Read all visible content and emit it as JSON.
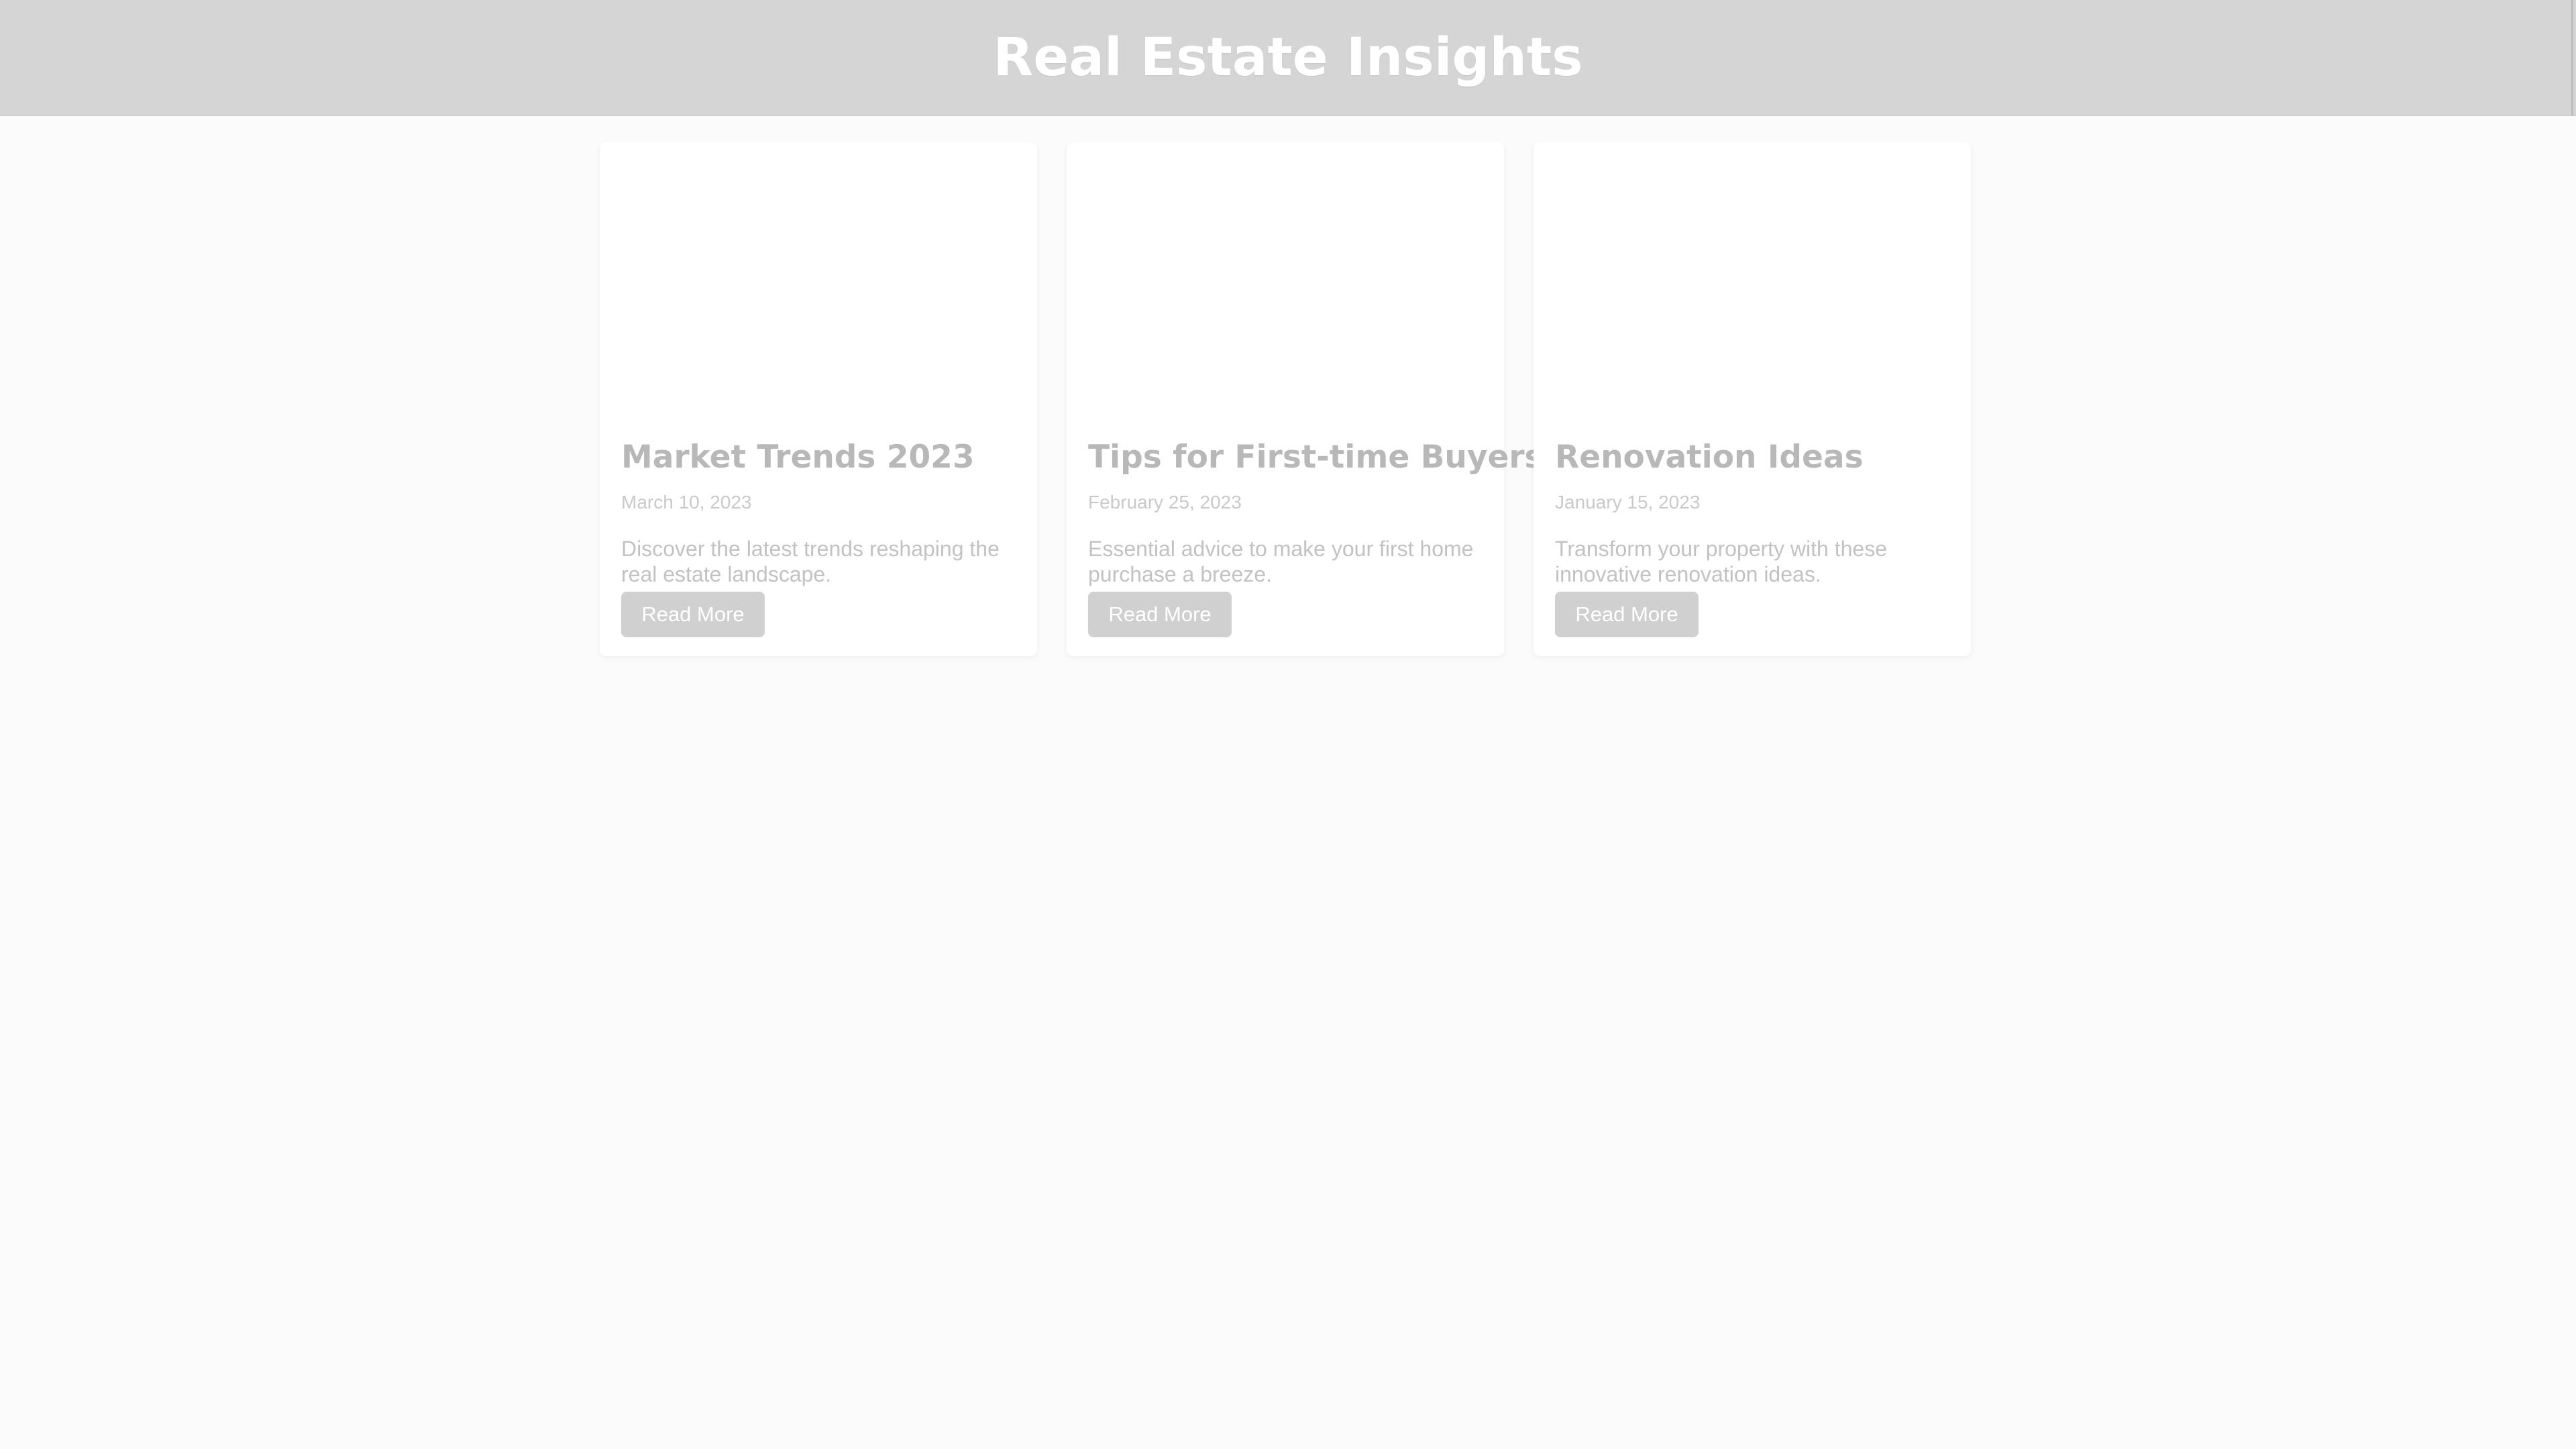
{
  "header": {
    "title": "Real Estate Insights"
  },
  "colors": {
    "header_bg": "#d5d5d5",
    "page_bg": "#fbfbfb",
    "card_bg": "#ffffff",
    "button_bg": "#d0d0d0",
    "title_text": "#b8b8b8"
  },
  "articles": [
    {
      "title": "Market Trends 2023",
      "date": "March 10, 2023",
      "description": "Discover the latest trends reshaping the real estate landscape.",
      "button_label": "Read More"
    },
    {
      "title": "Tips for First-time Buyers",
      "date": "February 25, 2023",
      "description": "Essential advice to make your first home purchase a breeze.",
      "button_label": "Read More"
    },
    {
      "title": "Renovation Ideas",
      "date": "January 15, 2023",
      "description": "Transform your property with these innovative renovation ideas.",
      "button_label": "Read More"
    }
  ]
}
